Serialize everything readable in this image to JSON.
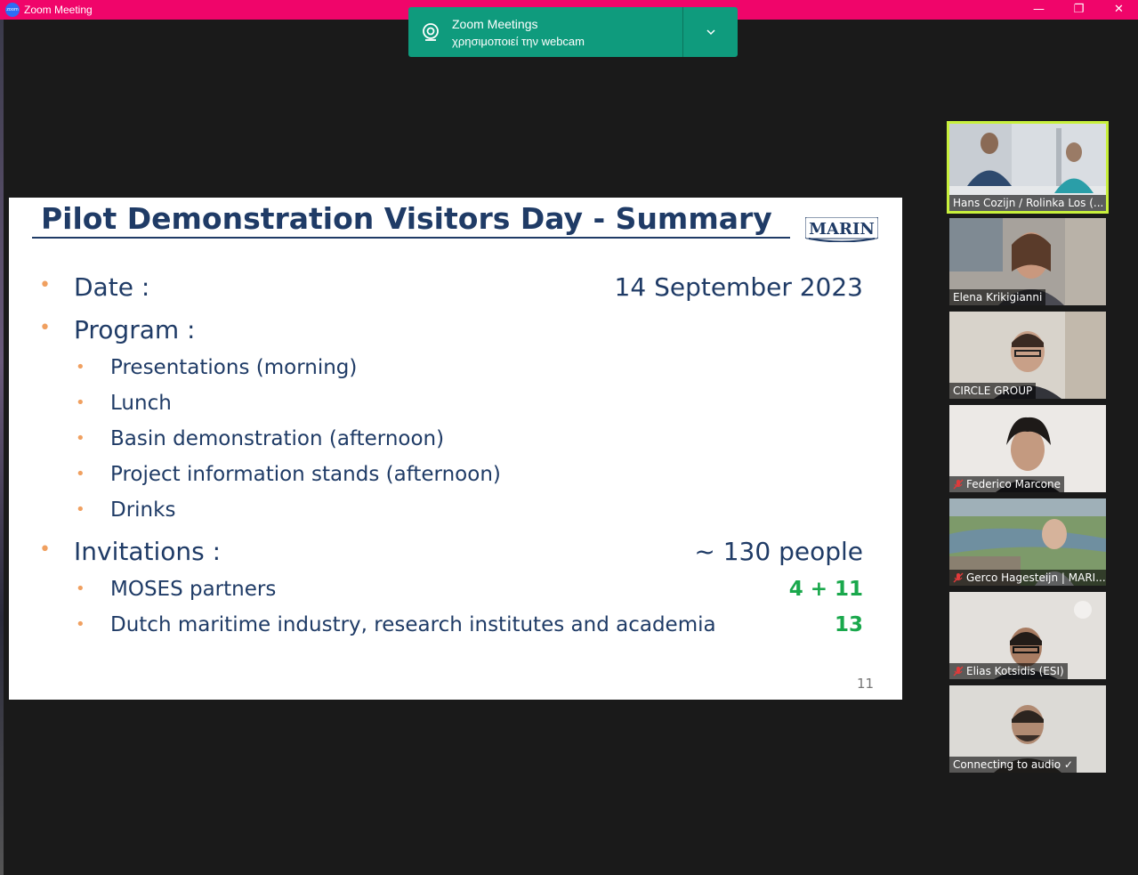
{
  "window": {
    "title": "Zoom Meeting",
    "logo_text": "zoom",
    "minimize_glyph": "—",
    "maximize_glyph": "❐",
    "close_glyph": "✕"
  },
  "toast": {
    "title": "Zoom Meetings",
    "body": "χρησιμοποιεί την webcam",
    "icon": "webcam-icon",
    "expand_glyph": "⌄"
  },
  "slide": {
    "title": "Pilot Demonstration Visitors Day - Summary",
    "logo_text": "MARIN",
    "page_number": "11",
    "items": [
      {
        "label": "Date :",
        "value": "14 September 2023"
      },
      {
        "label": "Program :"
      },
      {
        "label": "Presentations (morning)"
      },
      {
        "label": "Lunch"
      },
      {
        "label": "Basin demonstration (afternoon)"
      },
      {
        "label": "Project information stands (afternoon)"
      },
      {
        "label": "Drinks"
      },
      {
        "label": "Invitations :",
        "value": "~ 130 people"
      },
      {
        "label": "MOSES partners",
        "value": "4 + 11"
      },
      {
        "label": "Dutch maritime industry, research institutes and academia",
        "value": "13"
      }
    ],
    "bullet_glyph": "•"
  },
  "participants": [
    {
      "name": "Hans Cozijn / Rolinka Los (...",
      "muted": false,
      "active": true
    },
    {
      "name": "Elena Krikigianni",
      "muted": false,
      "active": false
    },
    {
      "name": "CIRCLE GROUP",
      "muted": false,
      "active": false
    },
    {
      "name": "Federico Marcone",
      "muted": true,
      "active": false
    },
    {
      "name": "Gerco Hagesteijn | MARI...",
      "muted": true,
      "active": false
    },
    {
      "name": "Elias Kotsidis (ESI)",
      "muted": true,
      "active": false
    },
    {
      "name": "Connecting to audio ✓",
      "muted": false,
      "active": false
    }
  ],
  "colors": {
    "titlebar": "#f0056a",
    "toast": "#0f9b7d",
    "slide_text": "#1f3b66",
    "bullet": "#f0a060",
    "highlight": "#1aa84c",
    "active_speaker": "#c8f03c",
    "mute": "#e03a3a"
  }
}
